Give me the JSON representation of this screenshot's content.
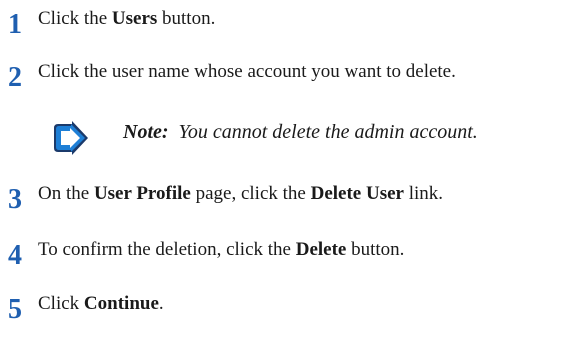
{
  "steps": [
    {
      "number": "1",
      "before": "Click the ",
      "bold": "Users",
      "after": " button."
    },
    {
      "number": "2",
      "text": "Click the user name whose account you want to delete."
    },
    {
      "number": "3",
      "before": "On the ",
      "bold": "User Profile",
      "middle": " page, click the ",
      "bold2": "Delete User",
      "after": " link."
    },
    {
      "number": "4",
      "before": "To confirm the deletion, click the ",
      "bold": "Delete",
      "after": " button."
    },
    {
      "number": "5",
      "before": "Click ",
      "bold": "Continue",
      "after": "."
    }
  ],
  "note": {
    "label": "Note:",
    "text": "You cannot delete the admin account.",
    "icon": "note-arrow-icon"
  },
  "colors": {
    "step_number": "#1f5fb0",
    "icon_fill": "#1e7fd6",
    "icon_outline": "#1b3a6b"
  }
}
